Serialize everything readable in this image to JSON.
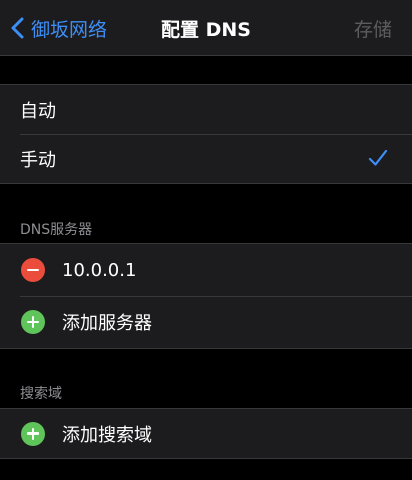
{
  "nav": {
    "back_label": "御坂网络",
    "title": "配置 DNS",
    "save_label": "存储"
  },
  "mode": {
    "options": [
      "自动",
      "手动"
    ],
    "selected": "手动"
  },
  "dns_servers": {
    "header": "DNS服务器",
    "entries": [
      "10.0.0.1"
    ],
    "add_label": "添加服务器"
  },
  "search_domains": {
    "header": "搜索域",
    "add_label": "添加搜索域"
  },
  "colors": {
    "accent": "#3e8ef7",
    "delete": "#eb4d3d",
    "add": "#5fc55a",
    "disabled": "#5c5c60"
  }
}
